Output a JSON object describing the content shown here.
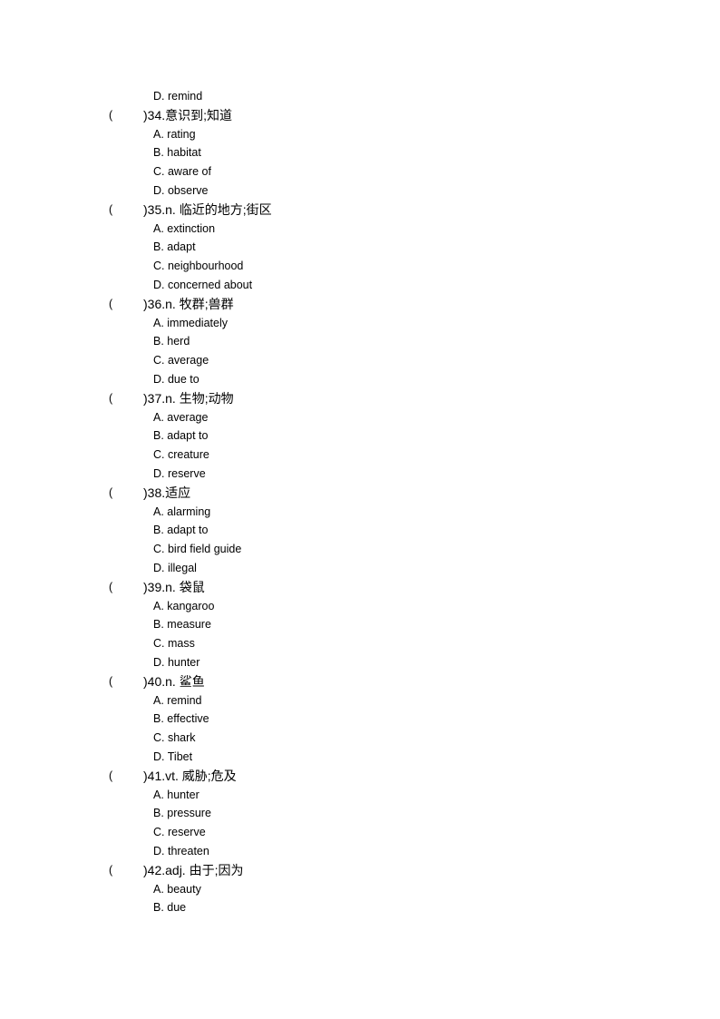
{
  "document": {
    "leading_options": [
      "D. remind"
    ],
    "questions": [
      {
        "paren_open": "(",
        "stem": ")34.意识到;知道",
        "options": [
          "A. rating",
          "B. habitat",
          "C. aware of",
          "D. observe"
        ]
      },
      {
        "paren_open": "(",
        "stem": ")35.n.  临近的地方;街区",
        "options": [
          "A. extinction",
          "B. adapt",
          "C. neighbourhood",
          "D. concerned about"
        ]
      },
      {
        "paren_open": "(",
        "stem": ")36.n.  牧群;兽群",
        "options": [
          "A. immediately",
          "B. herd",
          "C. average",
          "D. due to"
        ]
      },
      {
        "paren_open": "(",
        "stem": ")37.n.  生物;动物",
        "options": [
          "A. average",
          "B. adapt to",
          "C. creature",
          "D. reserve"
        ]
      },
      {
        "paren_open": "(",
        "stem": ")38.适应",
        "options": [
          "A. alarming",
          "B. adapt to",
          "C. bird field guide",
          "D. illegal"
        ]
      },
      {
        "paren_open": "(",
        "stem": ")39.n.  袋鼠",
        "options": [
          "A. kangaroo",
          "B. measure",
          "C. mass",
          "D. hunter"
        ]
      },
      {
        "paren_open": "(",
        "stem": ")40.n.  鲨鱼",
        "options": [
          "A. remind",
          "B. effective",
          "C. shark",
          "D. Tibet"
        ]
      },
      {
        "paren_open": "(",
        "stem": ")41.vt.  威胁;危及",
        "options": [
          "A. hunter",
          "B. pressure",
          "C. reserve",
          "D. threaten"
        ]
      },
      {
        "paren_open": "(",
        "stem": ")42.adj.  由于;因为",
        "options": [
          "A. beauty",
          "B. due"
        ]
      }
    ]
  }
}
